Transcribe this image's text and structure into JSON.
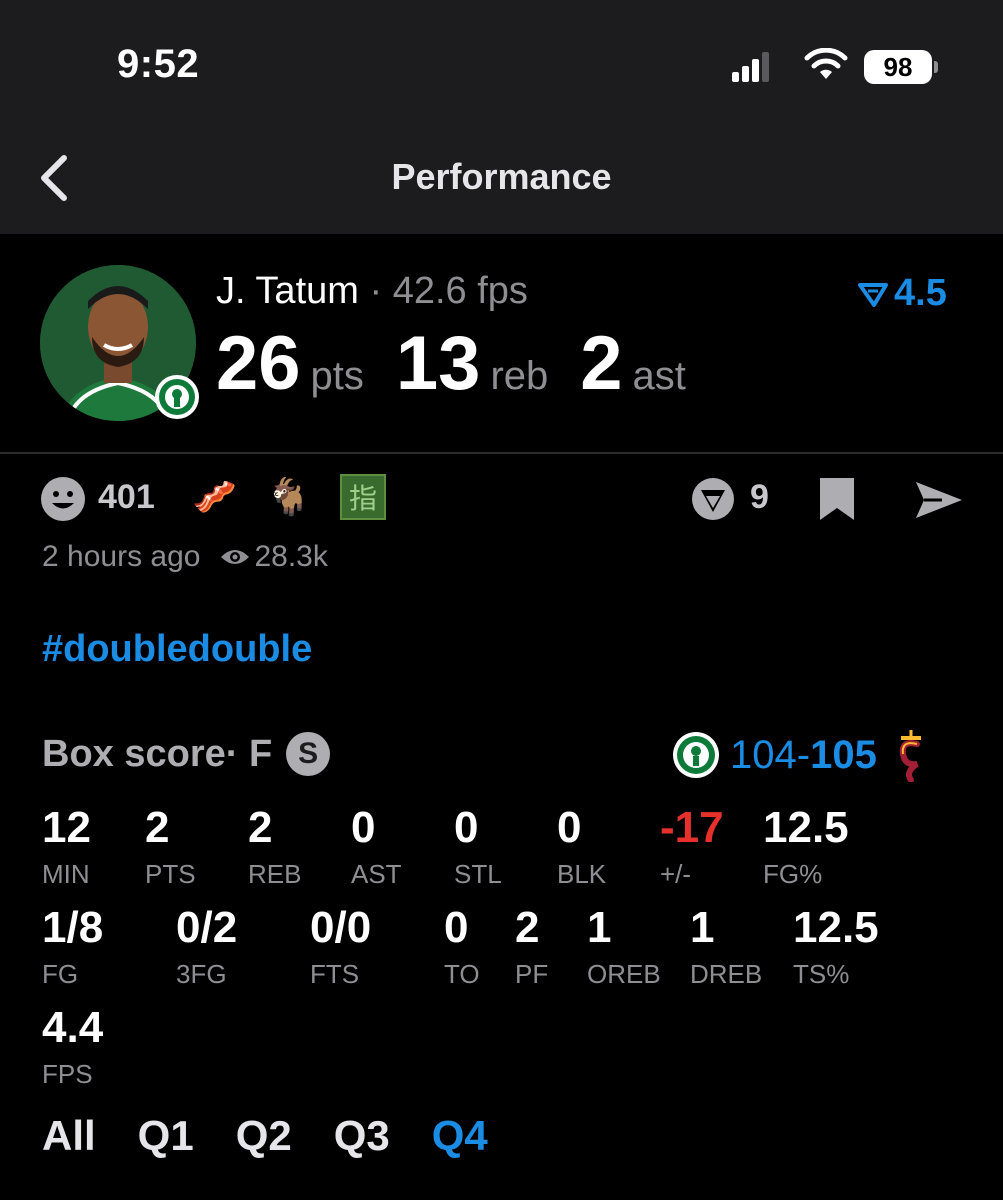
{
  "status_bar": {
    "time": "9:52",
    "battery": "98"
  },
  "nav": {
    "title": "Performance"
  },
  "player": {
    "name": "J. Tatum",
    "separator": " · ",
    "fps": "42.6 fps",
    "boost": "4.5",
    "stats": [
      {
        "value": "26",
        "unit": "pts"
      },
      {
        "value": "13",
        "unit": "reb"
      },
      {
        "value": "2",
        "unit": "ast"
      }
    ]
  },
  "reactions": {
    "smile_count": "401",
    "emojis": [
      "🥓",
      "🐐"
    ],
    "kanji": "指",
    "v_count": "9"
  },
  "meta": {
    "time_ago": "2 hours ago",
    "views": "28.3k"
  },
  "hashtag": "#doubledouble",
  "box_score": {
    "title": "Box score",
    "status": " · F",
    "badge": "S",
    "score_home": "104",
    "score_dash": "-",
    "score_away": "105",
    "row1": [
      {
        "value": "12",
        "label": "MIN"
      },
      {
        "value": "2",
        "label": "PTS"
      },
      {
        "value": "2",
        "label": "REB"
      },
      {
        "value": "0",
        "label": "AST"
      },
      {
        "value": "0",
        "label": "STL"
      },
      {
        "value": "0",
        "label": "BLK"
      },
      {
        "value": "-17",
        "label": "+/-"
      },
      {
        "value": "12.5",
        "label": "FG%"
      }
    ],
    "row2": [
      {
        "value": "1/8",
        "label": "FG"
      },
      {
        "value": "0/2",
        "label": "3FG"
      },
      {
        "value": "0/0",
        "label": "FTS"
      },
      {
        "value": "0",
        "label": "TO"
      },
      {
        "value": "2",
        "label": "PF"
      },
      {
        "value": "1",
        "label": "OREB"
      },
      {
        "value": "1",
        "label": "DREB"
      },
      {
        "value": "12.5",
        "label": "TS%"
      }
    ],
    "row3": [
      {
        "value": "4.4",
        "label": "FPS"
      }
    ],
    "quarters": [
      "All",
      "Q1",
      "Q2",
      "Q3",
      "Q4"
    ],
    "active_quarter": "Q4"
  },
  "colors": {
    "accent": "#1b8ce3",
    "negative": "#e5302c",
    "muted": "#8e8e93",
    "celtics_green": "#1f5a33"
  }
}
